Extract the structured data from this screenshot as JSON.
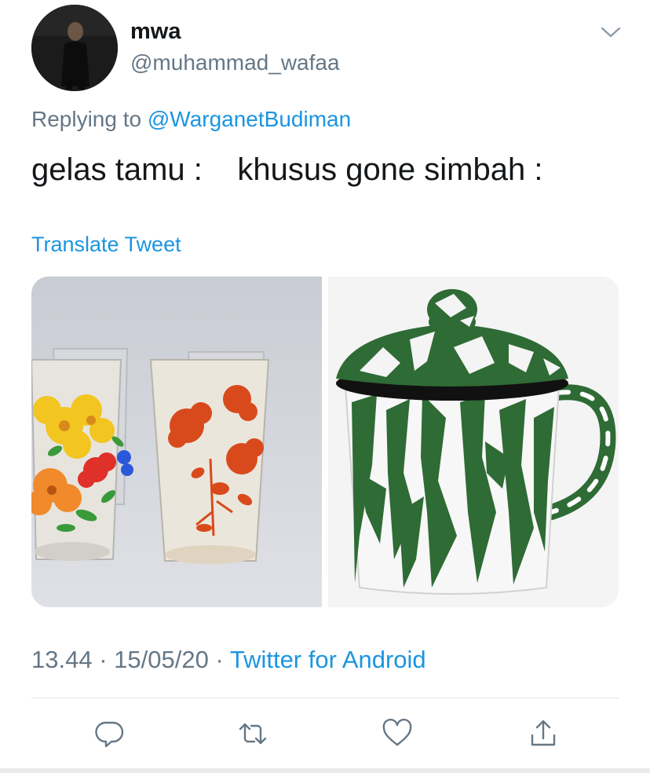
{
  "tweet": {
    "display_name": "mwa",
    "handle": "@muhammad_wafaa",
    "replying_prefix": "Replying to ",
    "replying_to": "@WarganetBudiman",
    "text": "gelas tamu :    khusus gone simbah :",
    "translate_label": "Translate Tweet",
    "time": "13.44",
    "date": "15/05/20",
    "separator": "·",
    "source": "Twitter for Android"
  },
  "media": [
    {
      "icon": "floral-glasses-photo"
    },
    {
      "icon": "green-enamel-mug-photo"
    }
  ],
  "actions": [
    {
      "icon": "reply-icon"
    },
    {
      "icon": "retweet-icon"
    },
    {
      "icon": "like-icon"
    },
    {
      "icon": "share-icon"
    }
  ],
  "colors": {
    "text": "#14171a",
    "secondary": "#657786",
    "link": "#1b95e0",
    "divider": "#e1e8ed",
    "mug_green": "#2f6b35"
  }
}
